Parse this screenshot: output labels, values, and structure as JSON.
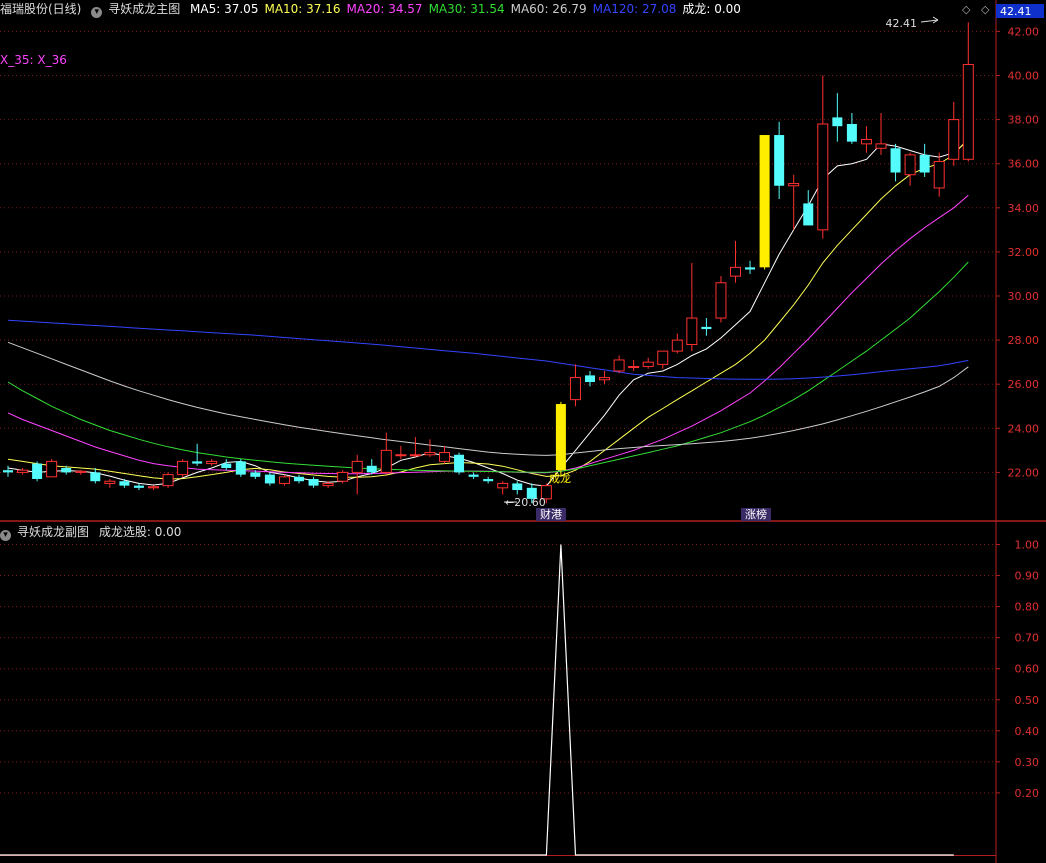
{
  "header": {
    "stock": "福瑞股份(日线)",
    "indicator": "寻妖成龙主图",
    "legend": [
      {
        "label": "MA5: 37.05",
        "color": "#ffffff"
      },
      {
        "label": "MA10: 37.16",
        "color": "#ffff55"
      },
      {
        "label": "MA20: 34.57",
        "color": "#ff44ff"
      },
      {
        "label": "MA30: 31.54",
        "color": "#33dd33"
      },
      {
        "label": "MA60: 26.79",
        "color": "#cccccc"
      },
      {
        "label": "MA120: 27.08",
        "color": "#3344ff"
      },
      {
        "label": "成龙: 0.00",
        "color": "#ffffff"
      }
    ],
    "x_label": "X_35: X_36",
    "current_price": "42.41"
  },
  "sub_header": {
    "indicator": "寻妖成龙副图",
    "value_label": "成龙选股: 0.00"
  },
  "annotations": {
    "high": "42.41",
    "low": "20.60",
    "signal": "成龙",
    "tag1": "财港",
    "tag2": "涨榜"
  },
  "chart_data": [
    {
      "type": "candlestick",
      "title": "寻妖成龙主图",
      "ylim": [
        20.5,
        42.7
      ],
      "y_ticks": [
        "22.00",
        "24.00",
        "26.00",
        "28.00",
        "30.00",
        "32.00",
        "34.00",
        "36.00",
        "38.00",
        "40.00",
        "42.00"
      ],
      "candles": [
        [
          22.1,
          22.3,
          21.8,
          22.0
        ],
        [
          22.0,
          22.2,
          21.9,
          22.1
        ],
        [
          22.4,
          22.5,
          21.6,
          21.7
        ],
        [
          21.8,
          22.6,
          21.8,
          22.5
        ],
        [
          22.2,
          22.3,
          21.9,
          22.0
        ],
        [
          22.0,
          22.1,
          21.9,
          22.05
        ],
        [
          22.0,
          22.2,
          21.5,
          21.6
        ],
        [
          21.5,
          21.7,
          21.3,
          21.6
        ],
        [
          21.6,
          21.7,
          21.3,
          21.4
        ],
        [
          21.4,
          21.5,
          21.2,
          21.3
        ],
        [
          21.3,
          21.4,
          21.2,
          21.35
        ],
        [
          21.4,
          22.0,
          21.3,
          21.9
        ],
        [
          21.9,
          22.6,
          21.8,
          22.5
        ],
        [
          22.5,
          23.3,
          22.3,
          22.4
        ],
        [
          22.4,
          22.6,
          22.3,
          22.5
        ],
        [
          22.4,
          22.6,
          22.1,
          22.2
        ],
        [
          22.5,
          22.6,
          21.8,
          21.9
        ],
        [
          22.0,
          22.1,
          21.7,
          21.8
        ],
        [
          21.9,
          22.0,
          21.4,
          21.5
        ],
        [
          21.5,
          21.9,
          21.4,
          21.8
        ],
        [
          21.8,
          21.9,
          21.5,
          21.6
        ],
        [
          21.7,
          21.8,
          21.3,
          21.4
        ],
        [
          21.4,
          21.6,
          21.3,
          21.5
        ],
        [
          21.6,
          22.1,
          21.5,
          22.0
        ],
        [
          22.0,
          22.8,
          21.0,
          22.5
        ],
        [
          22.3,
          22.6,
          21.9,
          22.0
        ],
        [
          22.0,
          23.8,
          21.9,
          23.0
        ],
        [
          22.8,
          23.2,
          22.6,
          22.8
        ],
        [
          22.8,
          23.6,
          22.7,
          22.8
        ],
        [
          22.8,
          23.5,
          22.7,
          22.9
        ],
        [
          22.5,
          23.2,
          22.4,
          22.9
        ],
        [
          22.8,
          22.9,
          21.9,
          22.0
        ],
        [
          21.9,
          22.0,
          21.7,
          21.8
        ],
        [
          21.7,
          21.8,
          21.5,
          21.6
        ],
        [
          21.3,
          21.6,
          21.0,
          21.5
        ],
        [
          21.5,
          21.6,
          21.0,
          21.2
        ],
        [
          21.3,
          21.5,
          20.6,
          20.8
        ],
        [
          20.8,
          21.5,
          20.6,
          21.4
        ],
        [
          22.1,
          25.2,
          21.8,
          25.1
        ],
        [
          25.3,
          26.9,
          25.0,
          26.3
        ],
        [
          26.4,
          26.6,
          25.9,
          26.1
        ],
        [
          26.2,
          26.6,
          26.0,
          26.3
        ],
        [
          26.6,
          27.3,
          26.5,
          27.1
        ],
        [
          26.8,
          27.1,
          26.6,
          26.8
        ],
        [
          26.8,
          27.2,
          26.7,
          27.0
        ],
        [
          26.9,
          27.4,
          26.7,
          27.5
        ],
        [
          27.5,
          28.3,
          27.4,
          28.0
        ],
        [
          27.8,
          31.5,
          27.5,
          29.0
        ],
        [
          28.6,
          29.0,
          28.2,
          28.5
        ],
        [
          29.0,
          30.9,
          28.8,
          30.6
        ],
        [
          30.9,
          32.5,
          30.6,
          31.3
        ],
        [
          31.3,
          31.6,
          31.0,
          31.2
        ],
        [
          31.3,
          37.3,
          31.2,
          37.3
        ],
        [
          37.3,
          37.9,
          34.4,
          35.0
        ],
        [
          35.0,
          35.5,
          33.0,
          35.1
        ],
        [
          34.2,
          34.8,
          33.2,
          33.2
        ],
        [
          33.0,
          40.0,
          32.6,
          37.8
        ],
        [
          38.1,
          39.2,
          37.0,
          37.7
        ],
        [
          37.8,
          38.3,
          36.9,
          37.0
        ],
        [
          36.9,
          37.7,
          36.5,
          37.1
        ],
        [
          36.7,
          38.3,
          36.4,
          36.9
        ],
        [
          36.7,
          36.9,
          35.2,
          35.6
        ],
        [
          35.5,
          36.5,
          35.0,
          36.4
        ],
        [
          36.4,
          36.9,
          35.4,
          35.6
        ],
        [
          34.9,
          36.5,
          34.5,
          36.1
        ],
        [
          36.2,
          38.8,
          35.9,
          38.0
        ],
        [
          36.2,
          42.41,
          36.1,
          40.5
        ]
      ],
      "series": [
        {
          "name": "MA5",
          "color": "#ffffff",
          "values": [
            22.2,
            22.1,
            22.0,
            22.05,
            22.08,
            22.05,
            21.98,
            21.83,
            21.65,
            21.5,
            21.43,
            21.5,
            21.75,
            22.0,
            22.2,
            22.45,
            22.5,
            22.3,
            22.0,
            21.9,
            21.75,
            21.62,
            21.55,
            21.6,
            21.8,
            21.95,
            22.2,
            22.55,
            22.7,
            22.9,
            22.75,
            22.65,
            22.45,
            22.2,
            21.95,
            21.65,
            21.45,
            21.38,
            22.2,
            23.0,
            23.8,
            24.6,
            25.5,
            26.2,
            26.5,
            26.6,
            26.9,
            27.3,
            27.6,
            28.1,
            28.7,
            29.3,
            30.6,
            31.9,
            33.0,
            34.1,
            35.3,
            35.9,
            36.0,
            36.2,
            36.9,
            36.8,
            36.6,
            36.4,
            36.3,
            36.5,
            37.05
          ]
        },
        {
          "name": "MA10",
          "color": "#ffff55",
          "values": [
            22.6,
            22.5,
            22.4,
            22.3,
            22.25,
            22.2,
            22.15,
            22.05,
            21.95,
            21.85,
            21.75,
            21.7,
            21.72,
            21.8,
            21.9,
            22.0,
            22.12,
            22.18,
            22.12,
            22.02,
            21.95,
            21.88,
            21.82,
            21.78,
            21.78,
            21.8,
            21.88,
            22.02,
            22.2,
            22.35,
            22.4,
            22.45,
            22.42,
            22.38,
            22.28,
            22.12,
            21.95,
            21.82,
            21.85,
            22.1,
            22.5,
            23.0,
            23.5,
            24.0,
            24.5,
            24.9,
            25.3,
            25.7,
            26.1,
            26.5,
            26.9,
            27.4,
            28.0,
            28.8,
            29.6,
            30.5,
            31.5,
            32.3,
            33.0,
            33.7,
            34.4,
            35.0,
            35.5,
            35.8,
            36.0,
            36.4,
            37.16
          ]
        },
        {
          "name": "MA20",
          "color": "#ff44ff",
          "values": [
            24.7,
            24.4,
            24.15,
            23.9,
            23.65,
            23.4,
            23.15,
            22.95,
            22.75,
            22.55,
            22.4,
            22.3,
            22.22,
            22.15,
            22.12,
            22.1,
            22.08,
            22.06,
            22.03,
            22.0,
            21.98,
            21.96,
            21.95,
            21.94,
            21.94,
            21.95,
            21.97,
            21.99,
            22.01,
            22.03,
            22.05,
            22.06,
            22.06,
            22.05,
            22.03,
            22.01,
            21.98,
            21.98,
            22.05,
            22.2,
            22.4,
            22.6,
            22.8,
            23.0,
            23.25,
            23.5,
            23.8,
            24.1,
            24.45,
            24.8,
            25.2,
            25.6,
            26.15,
            26.75,
            27.4,
            28.05,
            28.75,
            29.45,
            30.15,
            30.8,
            31.45,
            32.05,
            32.6,
            33.1,
            33.55,
            34.0,
            34.57
          ]
        },
        {
          "name": "MA30",
          "color": "#33dd33",
          "values": [
            26.1,
            25.7,
            25.35,
            25.0,
            24.7,
            24.4,
            24.15,
            23.9,
            23.7,
            23.5,
            23.32,
            23.16,
            23.02,
            22.9,
            22.8,
            22.7,
            22.62,
            22.55,
            22.48,
            22.42,
            22.37,
            22.32,
            22.28,
            22.24,
            22.2,
            22.17,
            22.14,
            22.12,
            22.1,
            22.08,
            22.07,
            22.06,
            22.05,
            22.04,
            22.03,
            22.02,
            22.01,
            22.0,
            22.05,
            22.15,
            22.3,
            22.45,
            22.6,
            22.75,
            22.9,
            23.05,
            23.2,
            23.4,
            23.6,
            23.8,
            24.05,
            24.3,
            24.6,
            24.95,
            25.3,
            25.7,
            26.15,
            26.6,
            27.05,
            27.5,
            28.0,
            28.5,
            29.0,
            29.6,
            30.2,
            30.85,
            31.54
          ]
        },
        {
          "name": "MA60",
          "color": "#cccccc",
          "values": [
            27.9,
            27.65,
            27.4,
            27.15,
            26.9,
            26.65,
            26.4,
            26.15,
            25.92,
            25.7,
            25.5,
            25.3,
            25.12,
            24.95,
            24.8,
            24.65,
            24.52,
            24.4,
            24.28,
            24.16,
            24.05,
            23.95,
            23.85,
            23.75,
            23.66,
            23.57,
            23.48,
            23.4,
            23.32,
            23.24,
            23.16,
            23.08,
            23.0,
            22.92,
            22.86,
            22.82,
            22.79,
            22.77,
            22.8,
            22.88,
            22.95,
            23.02,
            23.08,
            23.13,
            23.18,
            23.22,
            23.26,
            23.3,
            23.35,
            23.4,
            23.47,
            23.55,
            23.65,
            23.77,
            23.9,
            24.05,
            24.2,
            24.38,
            24.57,
            24.77,
            24.98,
            25.2,
            25.42,
            25.65,
            25.9,
            26.3,
            26.79
          ]
        },
        {
          "name": "MA120",
          "color": "#3344ff",
          "values": [
            28.9,
            28.86,
            28.82,
            28.78,
            28.74,
            28.7,
            28.66,
            28.62,
            28.58,
            28.54,
            28.5,
            28.46,
            28.42,
            28.38,
            28.34,
            28.3,
            28.26,
            28.22,
            28.17,
            28.12,
            28.07,
            28.02,
            27.97,
            27.92,
            27.87,
            27.82,
            27.76,
            27.7,
            27.64,
            27.58,
            27.52,
            27.46,
            27.4,
            27.33,
            27.26,
            27.19,
            27.12,
            27.05,
            26.95,
            26.85,
            26.75,
            26.65,
            26.55,
            26.45,
            26.4,
            26.35,
            26.3,
            26.28,
            26.26,
            26.24,
            26.23,
            26.22,
            26.22,
            26.23,
            26.25,
            26.28,
            26.32,
            26.37,
            26.43,
            26.5,
            26.57,
            26.64,
            26.7,
            26.76,
            26.84,
            26.95,
            27.08
          ]
        }
      ]
    },
    {
      "type": "line",
      "title": "寻妖成龙副图",
      "ylim": [
        0,
        1.05
      ],
      "y_ticks": [
        "0.20",
        "0.30",
        "0.40",
        "0.50",
        "0.60",
        "0.70",
        "0.80",
        "0.90",
        "1.00"
      ],
      "series": [
        {
          "name": "成龙选股",
          "color": "#ffffff",
          "values": [
            0,
            0,
            0,
            0,
            0,
            0,
            0,
            0,
            0,
            0,
            0,
            0,
            0,
            0,
            0,
            0,
            0,
            0,
            0,
            0,
            0,
            0,
            0,
            0,
            0,
            0,
            0,
            0,
            0,
            0,
            0,
            0,
            0,
            0,
            0,
            0,
            0,
            0,
            1,
            0,
            0,
            0,
            0,
            0,
            0,
            0,
            0,
            0,
            0,
            0,
            0,
            0,
            0,
            0,
            0,
            0,
            0,
            0,
            0,
            0,
            0,
            0,
            0,
            0,
            0,
            0,
            0
          ]
        }
      ]
    }
  ]
}
